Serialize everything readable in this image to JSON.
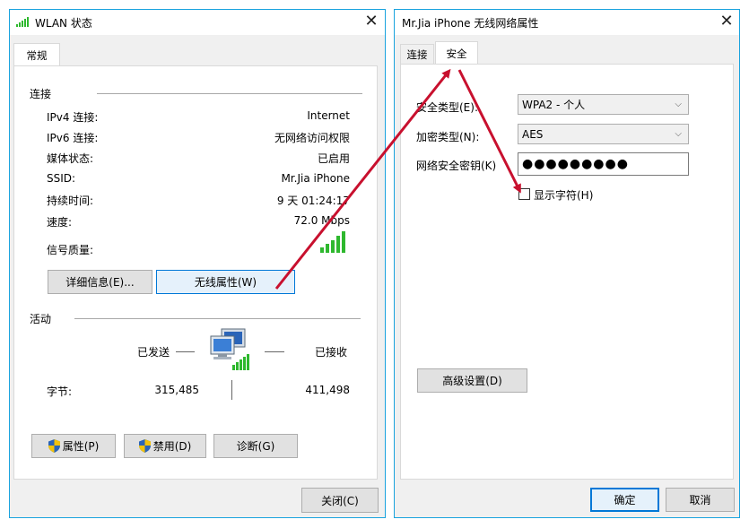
{
  "wlan_status": {
    "title": "WLAN 状态",
    "tab_general": "常规",
    "connection": {
      "section_label": "连接",
      "rows": [
        {
          "label": "IPv4 连接:",
          "value": "Internet"
        },
        {
          "label": "IPv6 连接:",
          "value": "无网络访问权限"
        },
        {
          "label": "媒体状态:",
          "value": "已启用"
        },
        {
          "label": "SSID:",
          "value": "Mr.Jia iPhone"
        },
        {
          "label": "持续时间:",
          "value": "9 天 01:24:17"
        },
        {
          "label": "速度:",
          "value": "72.0 Mbps"
        }
      ],
      "signal_label": "信号质量:",
      "signal_bars": 5,
      "details_button": "详细信息(E)...",
      "wireless_props_button": "无线属性(W)"
    },
    "activity": {
      "section_label": "活动",
      "sent_label": "已发送",
      "received_label": "已接收",
      "bytes_label": "字节:",
      "bytes_sent": "315,485",
      "bytes_received": "411,498"
    },
    "buttons": {
      "properties": "属性(P)",
      "disable": "禁用(D)",
      "diagnose": "诊断(G)",
      "close": "关闭(C)"
    }
  },
  "wireless_props": {
    "title": "Mr.Jia iPhone 无线网络属性",
    "tabs": [
      "连接",
      "安全"
    ],
    "active_tab": "安全",
    "security_type_label": "安全类型(E):",
    "security_type_value": "WPA2 - 个人",
    "encryption_type_label": "加密类型(N):",
    "encryption_type_value": "AES",
    "key_label": "网络安全密钥(K)",
    "key_value": "●●●●●●●●●",
    "show_chars_label": "显示字符(H)",
    "show_chars_checked": false,
    "advanced_button": "高级设置(D)",
    "ok_button": "确定",
    "cancel_button": "取消"
  },
  "colors": {
    "accent": "#0078d7",
    "border": "#1aa3de",
    "signal_green": "#2eb82e",
    "annotation_arrow": "#c8102e"
  }
}
